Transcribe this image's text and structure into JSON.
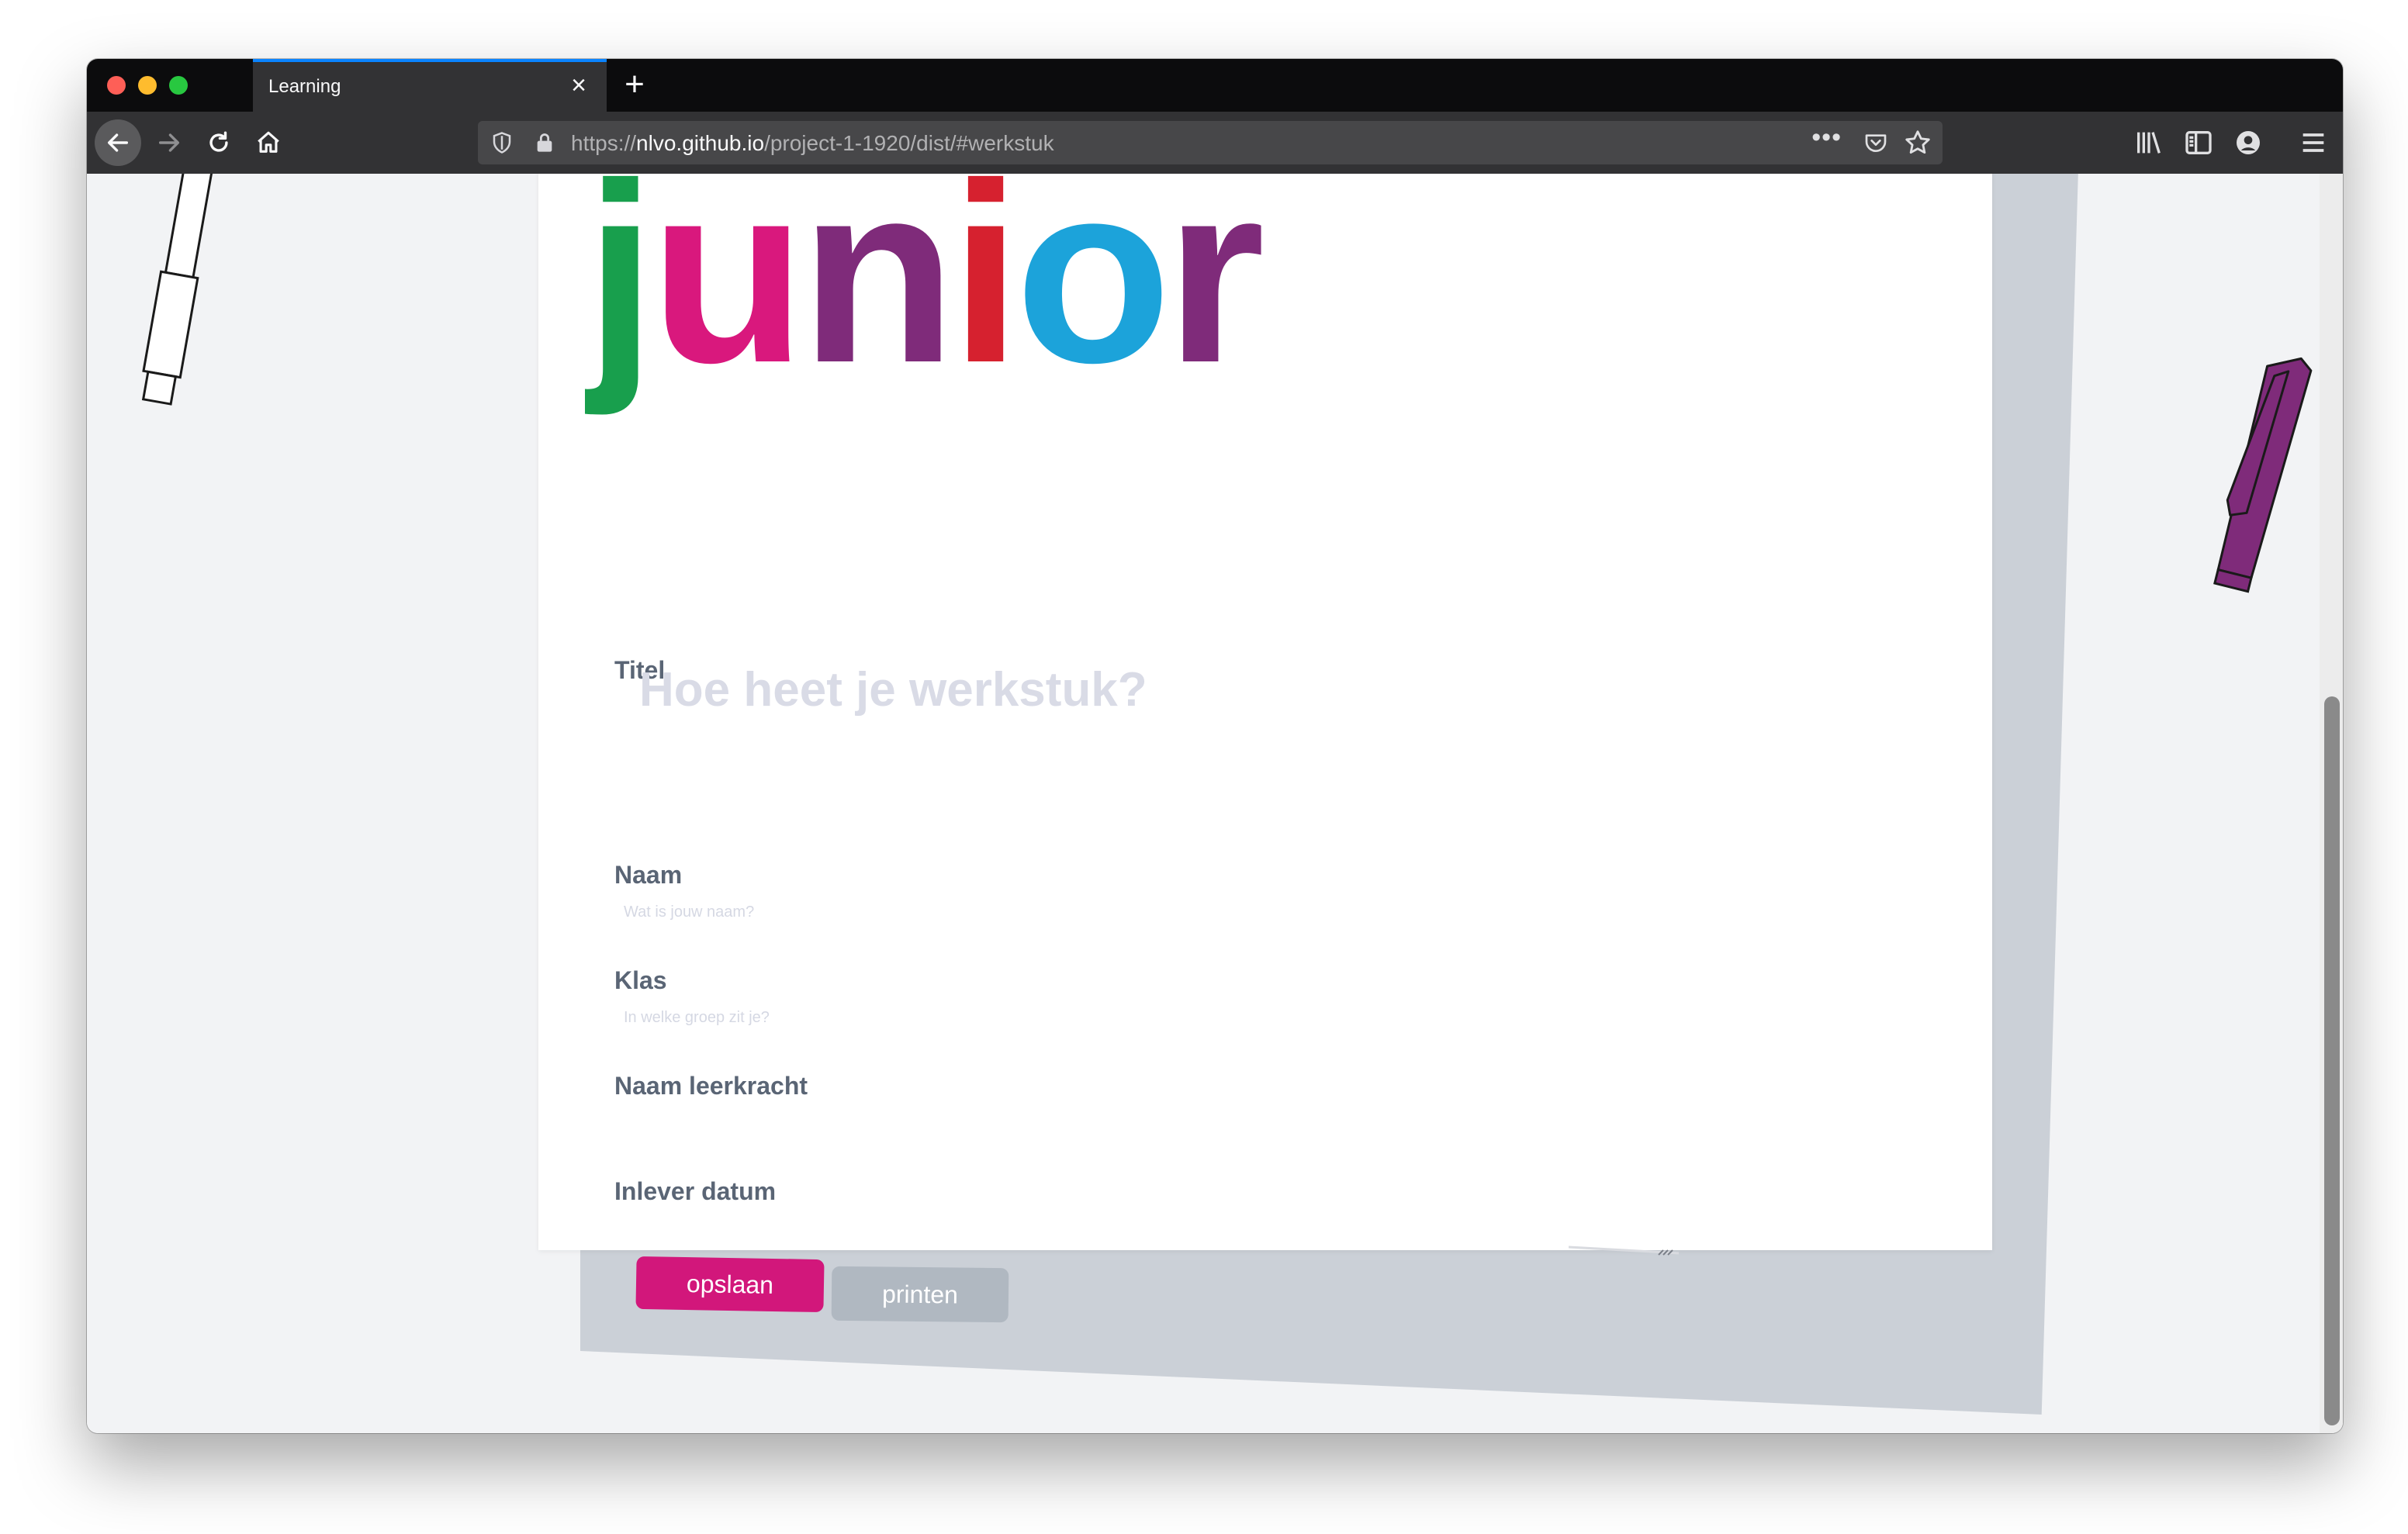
{
  "browser": {
    "tab_title": "Learning",
    "url_scheme": "https://",
    "url_host": "nlvo.github.io",
    "url_path": "/project-1-1920/dist/#werkstuk",
    "more_label": "•••"
  },
  "logo": {
    "letters": [
      "j",
      "u",
      "n",
      "i",
      "o",
      "r"
    ],
    "colors": [
      "#189f4d",
      "#d9187d",
      "#7f2b7a",
      "#d6212f",
      "#1ca3da",
      "#7f2b7a"
    ]
  },
  "form": {
    "title_label": "Titel",
    "title_placeholder": "Hoe heet je werkstuk?",
    "name_label": "Naam",
    "name_placeholder": "Wat is jouw naam?",
    "class_label": "Klas",
    "class_placeholder": "In welke groep zit je?",
    "teacher_label": "Naam leerkracht",
    "teacher_placeholder": "",
    "date_label": "Inlever datum",
    "date_placeholder": ""
  },
  "actions": {
    "save_label": "opslaan",
    "print_label": "printen"
  },
  "colors": {
    "accent_pink": "#d2177b",
    "button_gray": "#b0b8c1",
    "label_gray": "#5a6575"
  }
}
